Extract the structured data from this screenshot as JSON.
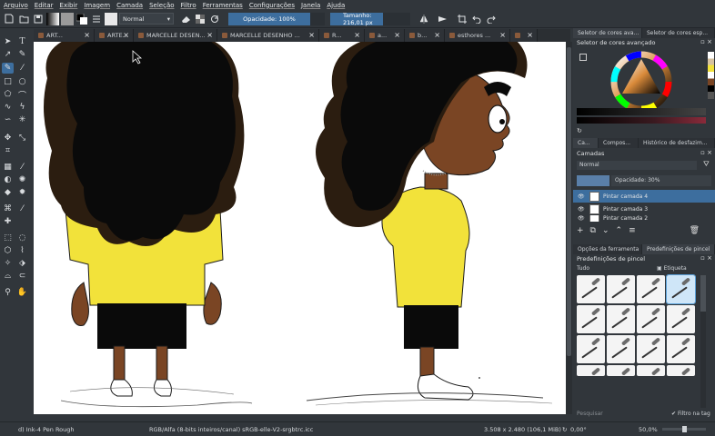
{
  "menu": [
    "Arquivo",
    "Editar",
    "Exibir",
    "Imagem",
    "Camada",
    "Seleção",
    "Filtro",
    "Ferramentas",
    "Configurações",
    "Janela",
    "Ajuda"
  ],
  "toolbar": {
    "blend_mode": "Normal",
    "opacity_label": "Opacidade: 100%",
    "size_label": "Tamanho: 216,01 px"
  },
  "tabs": [
    {
      "label": "ART..."
    },
    {
      "label": "ARTE..."
    },
    {
      "label": "MARCELLE DESEN..."
    },
    {
      "label": "MARCELLE DESENHO ..."
    },
    {
      "label": "R..."
    },
    {
      "label": "a..."
    },
    {
      "label": "b..."
    },
    {
      "label": "esthores ..."
    },
    {
      "label": ""
    }
  ],
  "docker": {
    "top_tabs": [
      "Seletor de cores ava...",
      "Seletor de cores esp..."
    ],
    "color_header": "Seletor de cores avançado",
    "layer_tabs": [
      "Ca...",
      "Compos...",
      "Histórico de desfazim..."
    ],
    "layers_header": "Camadas",
    "layers_blend": "Normal",
    "layers_opacity": "Opacidade:  30%",
    "layers": [
      {
        "name": "Pintar camada 4",
        "selected": true
      },
      {
        "name": "Pintar camada 3",
        "selected": false
      },
      {
        "name": "Pintar camada 2",
        "selected": false
      }
    ],
    "tool_tabs": [
      "Opções da ferramenta",
      "Predefinições de pincel"
    ],
    "presets_header": "Predefinições de pincel",
    "preset_filter": "Tudo",
    "preset_tag": "Etiqueta",
    "search_placeholder": "Pesquisar",
    "filter_by_tag": "Filtro na tag"
  },
  "status": {
    "brush": "d) Ink-4 Pen Rough",
    "color_space": "RGB/Alfa (8-bits inteiros/canal)  sRGB-elle-V2-srgbtrc.icc",
    "image_size": "3.508 x 2.480 (106,1 MiB)",
    "rotation": "0,00°",
    "zoom": "50,0%"
  },
  "colors": {
    "accent": "#3d6e9e",
    "skin": "#7a4524",
    "shirt": "#f2e23a",
    "hair": "#0a0a0a",
    "hair_shade": "#2b1d10"
  }
}
